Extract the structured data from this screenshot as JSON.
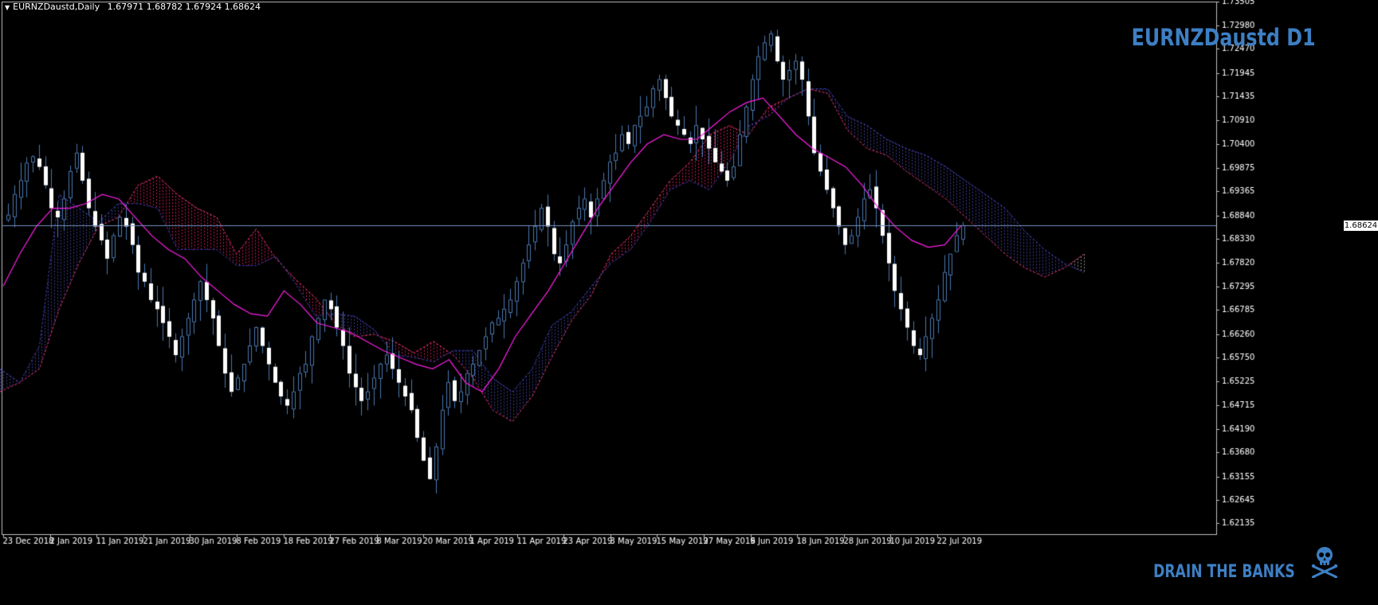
{
  "header": {
    "symbol": "EURNZDaustd,Daily",
    "ohlc": "1.67971 1.68782 1.67924 1.68624"
  },
  "watermark": "EURNZDaustd D1",
  "footer_text": "DRAIN THE BANKS",
  "colors": {
    "background": "#000000",
    "candle_up": "#4a78b0",
    "candle_down": "#ffffff",
    "tenkan": "#ff1ee8",
    "kumo_bull": "#3a3aa0",
    "kumo_bear": "#ff2060",
    "chikou": "#ffffff",
    "current_price_line": "#7090c0",
    "brand": "#3d7fc4",
    "axis": "#c0c0c0"
  },
  "icons": [
    "skull-crossbones-icon"
  ],
  "chart_data": {
    "type": "candlestick",
    "title": "EURNZDaustd,Daily",
    "current_price": 1.68624,
    "ylim": [
      1.619,
      1.735
    ],
    "y_ticks": [
      "1.73505",
      "1.72980",
      "1.72470",
      "1.71945",
      "1.71435",
      "1.70910",
      "1.70400",
      "1.69875",
      "1.69365",
      "1.68840",
      "1.68330",
      "1.67820",
      "1.67295",
      "1.66785",
      "1.66260",
      "1.65750",
      "1.65225",
      "1.64715",
      "1.64190",
      "1.63680",
      "1.63155",
      "1.62645",
      "1.62135"
    ],
    "x_ticks": [
      "23 Dec 2018",
      "2 Jan 2019",
      "11 Jan 2019",
      "21 Jan 2019",
      "30 Jan 2019",
      "8 Feb 2019",
      "18 Feb 2019",
      "27 Feb 2019",
      "8 Mar 2019",
      "20 Mar 2019",
      "1 Apr 2019",
      "11 Apr 2019",
      "23 Apr 2019",
      "3 May 2019",
      "15 May 2019",
      "27 May 2019",
      "6 Jun 2019",
      "18 Jun 2019",
      "28 Jun 2019",
      "10 Jul 2019",
      "22 Jul 2019"
    ],
    "close_path": [
      1.6885,
      1.693,
      1.696,
      1.6998,
      1.7012,
      1.699,
      1.695,
      1.69,
      1.688,
      1.692,
      1.698,
      1.702,
      1.696,
      1.69,
      1.686,
      1.683,
      1.679,
      1.684,
      1.688,
      1.686,
      1.682,
      1.676,
      1.674,
      1.67,
      1.668,
      1.665,
      1.662,
      1.658,
      1.662,
      1.666,
      1.67,
      1.674,
      1.67,
      1.666,
      1.66,
      1.654,
      1.65,
      1.653,
      1.656,
      1.66,
      1.664,
      1.66,
      1.656,
      1.652,
      1.649,
      1.647,
      1.65,
      1.654,
      1.656,
      1.662,
      1.666,
      1.67,
      1.668,
      1.664,
      1.66,
      1.654,
      1.651,
      1.648,
      1.65,
      1.653,
      1.656,
      1.658,
      1.655,
      1.652,
      1.649,
      1.646,
      1.64,
      1.635,
      1.631,
      1.638,
      1.646,
      1.652,
      1.648,
      1.65,
      1.654,
      1.656,
      1.659,
      1.662,
      1.665,
      1.666,
      1.668,
      1.67,
      1.674,
      1.678,
      1.682,
      1.686,
      1.69,
      1.686,
      1.68,
      1.678,
      1.682,
      1.687,
      1.69,
      1.692,
      1.688,
      1.692,
      1.696,
      1.7,
      1.702,
      1.706,
      1.704,
      1.708,
      1.71,
      1.712,
      1.716,
      1.718,
      1.714,
      1.71,
      1.708,
      1.706,
      1.704,
      1.708,
      1.705,
      1.703,
      1.7,
      1.698,
      1.696,
      1.699,
      1.706,
      1.712,
      1.718,
      1.723,
      1.726,
      1.728,
      1.722,
      1.718,
      1.72,
      1.722,
      1.718,
      1.71,
      1.702,
      1.698,
      1.694,
      1.69,
      1.686,
      1.682,
      1.684,
      1.688,
      1.692,
      1.694,
      1.69,
      1.684,
      1.678,
      1.672,
      1.668,
      1.664,
      1.66,
      1.658,
      1.662,
      1.666,
      1.67,
      1.676,
      1.68,
      1.684,
      1.6862
    ]
  },
  "indicators": {
    "tenkan": [
      1.673,
      1.68,
      1.686,
      1.69,
      1.69,
      1.691,
      1.693,
      1.692,
      1.688,
      1.684,
      1.681,
      1.679,
      1.675,
      1.672,
      1.669,
      1.667,
      1.6665,
      1.672,
      1.669,
      1.665,
      1.664,
      1.663,
      1.661,
      1.659,
      1.6575,
      1.656,
      1.655,
      1.657,
      1.652,
      1.65,
      1.655,
      1.662,
      1.667,
      1.672,
      1.678,
      1.684,
      1.69,
      1.695,
      1.7,
      1.704,
      1.706,
      1.705,
      1.705,
      1.708,
      1.711,
      1.713,
      1.714,
      1.71,
      1.706,
      1.703,
      1.701,
      1.699,
      1.695,
      1.69,
      1.686,
      1.683,
      1.6815,
      1.682,
      1.6862
    ],
    "span_a": [
      1.65,
      1.652,
      1.655,
      1.668,
      1.678,
      1.686,
      1.688,
      1.695,
      1.697,
      1.693,
      1.69,
      1.688,
      1.68,
      1.6855,
      1.679,
      1.6745,
      1.6705,
      1.665,
      1.662,
      1.6625,
      1.661,
      1.6585,
      1.661,
      1.658,
      1.653,
      1.646,
      1.6435,
      1.649,
      1.6575,
      1.6655,
      1.671,
      1.68,
      1.684,
      1.69,
      1.696,
      1.7,
      1.706,
      1.708,
      1.706,
      1.712,
      1.714,
      1.716,
      1.715,
      1.707,
      1.703,
      1.7015,
      1.698,
      1.695,
      1.692,
      1.688,
      1.684,
      1.68,
      1.677,
      1.675,
      1.677,
      1.68
    ],
    "span_b": [
      1.655,
      1.652,
      1.66,
      1.693,
      1.69,
      1.687,
      1.691,
      1.691,
      1.69,
      1.681,
      1.681,
      1.681,
      1.6775,
      1.6775,
      1.6795,
      1.6735,
      1.6665,
      1.667,
      1.6665,
      1.6635,
      1.658,
      1.6575,
      1.6565,
      1.659,
      1.659,
      1.653,
      1.65,
      1.655,
      1.6645,
      1.6675,
      1.673,
      1.678,
      1.681,
      1.687,
      1.694,
      1.696,
      1.694,
      1.7,
      1.708,
      1.71,
      1.714,
      1.716,
      1.716,
      1.71,
      1.708,
      1.705,
      1.703,
      1.7015,
      1.699,
      1.696,
      1.693,
      1.69,
      1.685,
      1.681,
      1.678,
      1.676
    ]
  }
}
